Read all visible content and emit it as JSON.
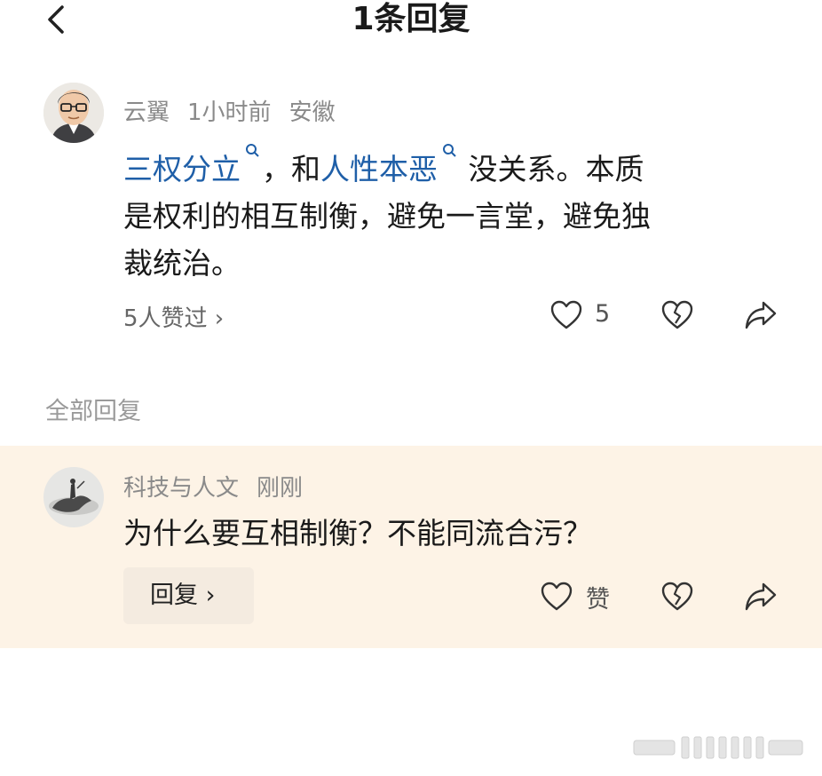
{
  "header": {
    "title": "1条回复"
  },
  "comment": {
    "user": "云翼",
    "time": "1小时前",
    "location": "安徽",
    "link1": "三权分立",
    "text_a": "，和",
    "link2": "人性本恶",
    "text_b": "没关系。本质",
    "line2": "是权利的相互制衡，避免一言堂，避免独",
    "line3": "裁统治。",
    "liked_by": "5人赞过 ›",
    "like_count": "5"
  },
  "section": {
    "label": "全部回复"
  },
  "reply": {
    "user": "科技与人文",
    "time": "刚刚",
    "text": "为什么要互相制衡？不能同流合污？",
    "reply_button": "回复 ›",
    "like_label": "赞"
  },
  "colors": {
    "link": "#1f5fa8",
    "reply_bg": "#fdf3e6"
  }
}
